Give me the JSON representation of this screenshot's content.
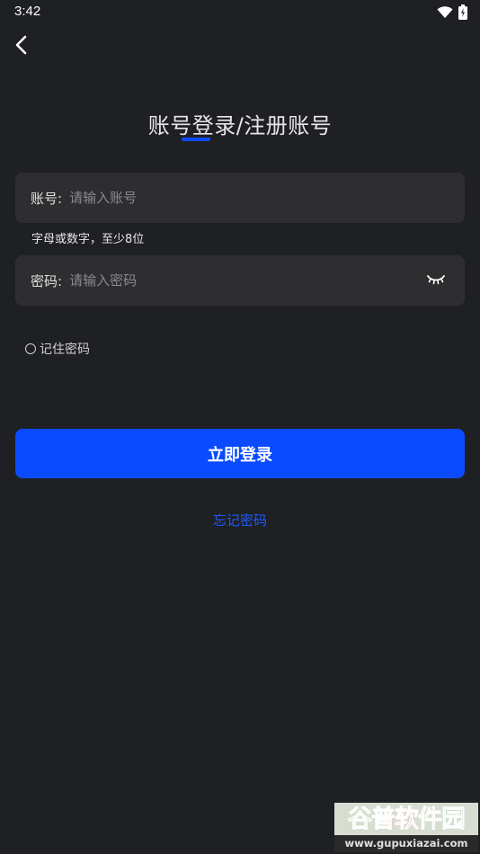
{
  "status_bar": {
    "time": "3:42",
    "icons": [
      "wifi-icon",
      "battery-icon"
    ]
  },
  "header": {
    "back_icon": "chevron-left-icon",
    "title": "账号登录/注册账号"
  },
  "form": {
    "account": {
      "label": "账号:",
      "placeholder": "请输入账号",
      "value": "",
      "hint": "字母或数字，至少8位"
    },
    "password": {
      "label": "密码:",
      "placeholder": "请输入密码",
      "value": "",
      "toggle_icon": "eye-closed-icon"
    },
    "remember": {
      "label": "记住密码",
      "checked": false
    },
    "login_button": "立即登录",
    "forgot_link": "忘记密码"
  },
  "watermark": {
    "name": "谷普软件园",
    "url": "www.gupuxiazai.com"
  },
  "colors": {
    "background": "#1f2024",
    "field_background": "#2e2e31",
    "accent": "#0a4bff",
    "link": "#1f5bff"
  }
}
